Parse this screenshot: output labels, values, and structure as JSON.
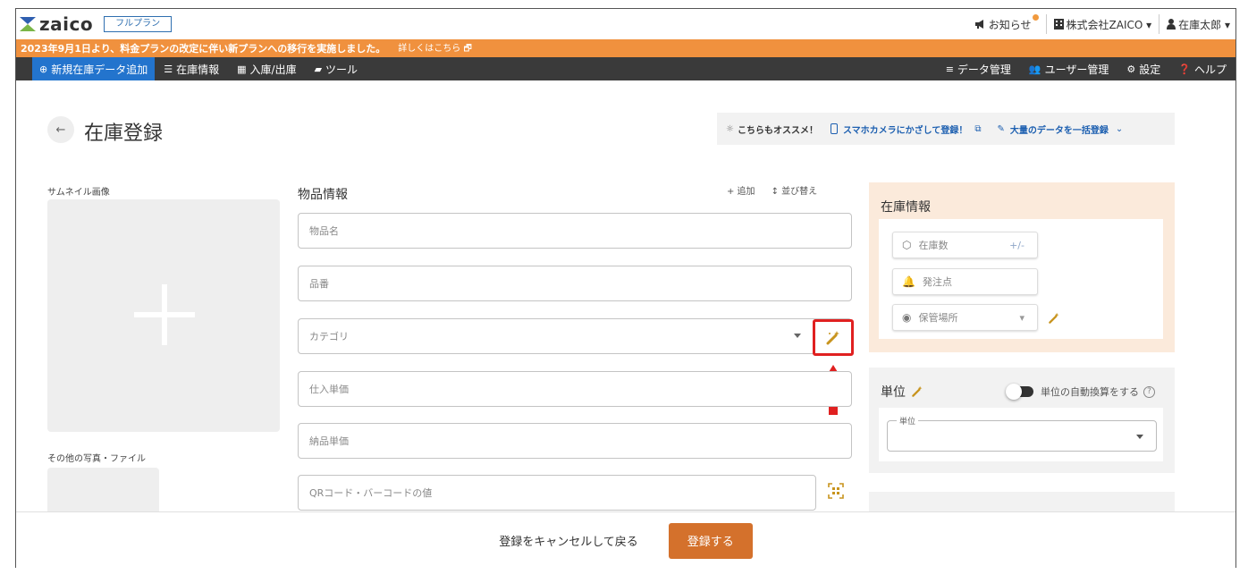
{
  "header": {
    "logo_text": "zaico",
    "plan_badge": "フルプラン",
    "notice": "お知らせ",
    "company": "株式会社ZAICO ▾",
    "user": "在庫太郎 ▾"
  },
  "banner": {
    "text": "2023年9月1日より、料金プランの改定に伴い新プランへの移行を実施しました。",
    "link": "詳しくはこちら"
  },
  "nav": {
    "add_new": "新規在庫データ追加",
    "stock_info": "在庫情報",
    "in_out": "入庫/出庫",
    "tools": "ツール",
    "data_mgmt": "データ管理",
    "user_mgmt": "ユーザー管理",
    "settings": "設定",
    "help": "ヘルプ"
  },
  "page": {
    "back_icon": "←",
    "title": "在庫登録"
  },
  "recommend": {
    "lead": "こちらもオススメ！",
    "camera": "スマホカメラにかざして登録！",
    "bulk": "大量のデータを一括登録"
  },
  "thumbnail": {
    "label": "サムネイル画像",
    "other_label": "その他の写真・ファイル"
  },
  "item_info": {
    "title": "物品情報",
    "add": "+ 追加",
    "sort": "並び替え",
    "fields": {
      "name": "物品名",
      "code": "品番",
      "category": "カテゴリ",
      "purchase_price": "仕入単価",
      "delivery_price": "納品単価",
      "qr": "QRコード・バーコードの値"
    }
  },
  "stock_info": {
    "title": "在庫情報",
    "quantity": "在庫数",
    "quantity_tail": "+/-",
    "reorder_point": "発注点",
    "location": "保管場所"
  },
  "unit": {
    "title": "単位",
    "auto_convert": "単位の自動換算をする",
    "help": "?",
    "select_label": "単位"
  },
  "footer": {
    "cancel": "登録をキャンセルして戻る",
    "submit": "登録する"
  },
  "colors": {
    "banner": "#f0913e",
    "nav": "#3a3a3a",
    "primary_nav": "#2374cd",
    "submit": "#d4712c",
    "highlight": "#e02020",
    "wand": "#c8941e"
  }
}
